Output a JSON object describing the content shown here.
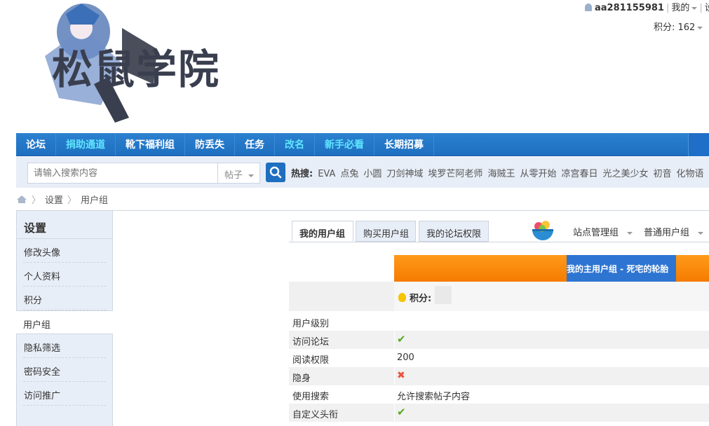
{
  "logo": {
    "text": "松鼠学院"
  },
  "user": {
    "name": "aa281155981",
    "my_label": "我的",
    "extra": "设",
    "score_label": "积分: 162"
  },
  "nav": {
    "items": [
      {
        "label": "论坛",
        "color": "#ffffff"
      },
      {
        "label": "捐助通道",
        "color": "#5fe6ff"
      },
      {
        "label": "靴下福利组",
        "color": "#ffffff"
      },
      {
        "label": "防丢失",
        "color": "#ffffff"
      },
      {
        "label": "任务",
        "color": "#ffffff"
      },
      {
        "label": "改名",
        "color": "#5fe6ff"
      },
      {
        "label": "新手必看",
        "color": "#5fe6ff"
      },
      {
        "label": "长期招募",
        "color": "#ffffff"
      }
    ]
  },
  "search": {
    "placeholder": "请输入搜索内容",
    "type": "帖子",
    "hot_label": "热搜:",
    "hot": [
      "EVA",
      "点兔",
      "小圆",
      "刀剑神域",
      "埃罗芒阿老师",
      "海贼王",
      "从零开始",
      "凉宫春日",
      "光之美少女",
      "初音",
      "化物语"
    ]
  },
  "breadcrumb": [
    "设置",
    "用户组"
  ],
  "sidebar": {
    "title": "设置",
    "items": [
      "修改头像",
      "个人资料",
      "积分",
      "用户组",
      "隐私筛选",
      "密码安全",
      "访问推广"
    ],
    "active": "用户组"
  },
  "tabs": [
    "我的用户组",
    "购买用户组",
    "我的论坛权限"
  ],
  "dropdowns": [
    "站点管理组",
    "普通用户组"
  ],
  "group": {
    "title": "我的主用户组 - 死宅的轮胎",
    "score_label": "积分:"
  },
  "rows": [
    {
      "label": "用户级别",
      "type": "text",
      "value": ""
    },
    {
      "label": "访问论坛",
      "type": "check",
      "value": ""
    },
    {
      "label": "阅读权限",
      "type": "text",
      "value": "200"
    },
    {
      "label": "隐身",
      "type": "cross",
      "value": ""
    },
    {
      "label": "使用搜索",
      "type": "text",
      "value": "允许搜索帖子内容"
    },
    {
      "label": "自定义头衔",
      "type": "check",
      "value": ""
    }
  ]
}
